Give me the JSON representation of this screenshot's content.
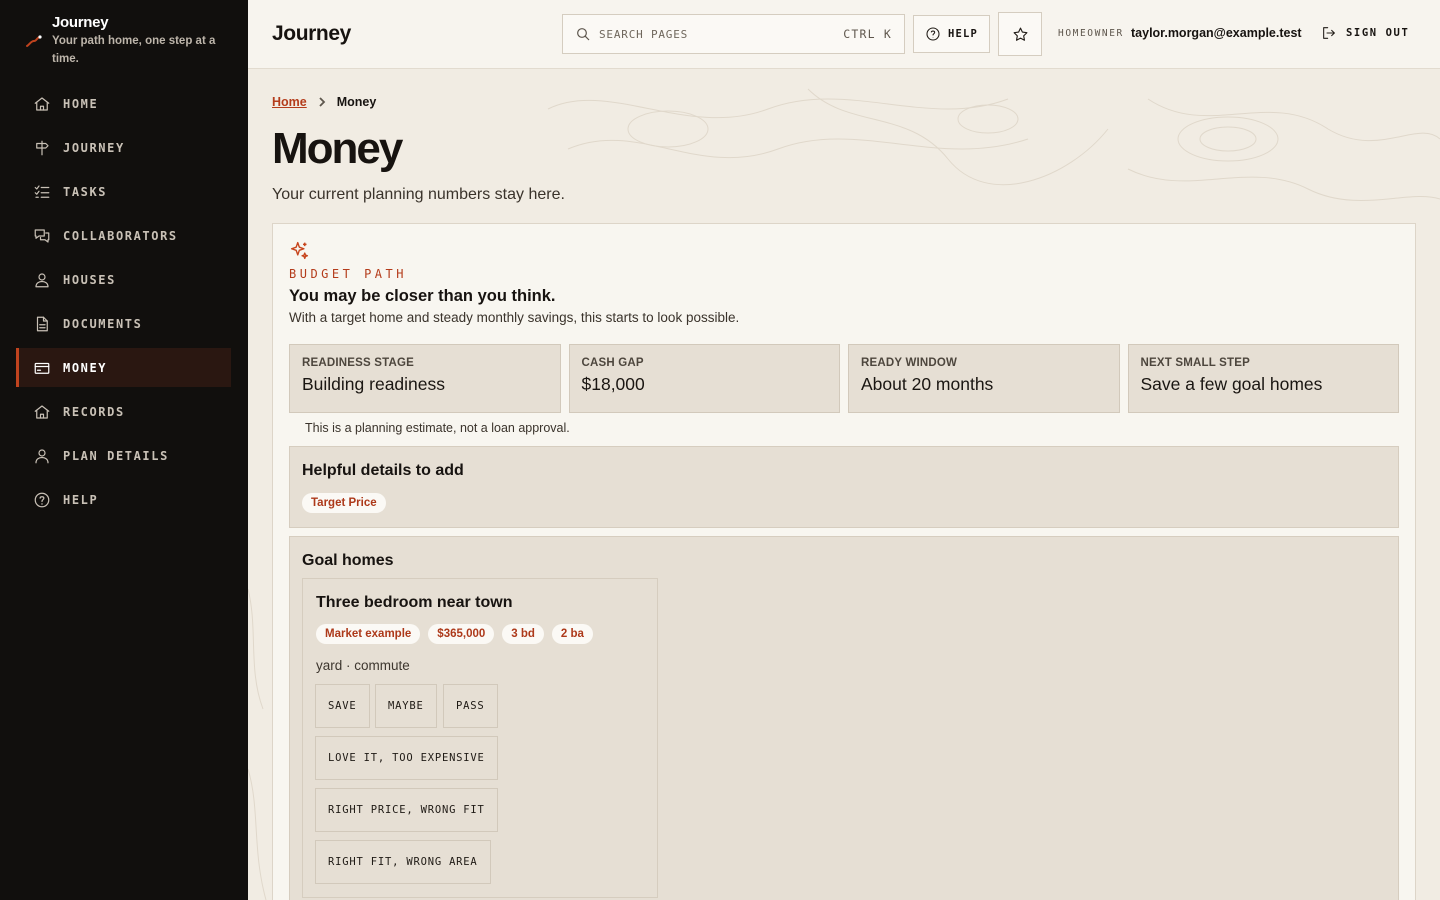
{
  "brand": {
    "title": "Journey",
    "tagline": "Your path home, one step at a time.",
    "accent": "#c0431e"
  },
  "nav": [
    {
      "label": "HOME",
      "icon": "home-icon"
    },
    {
      "label": "JOURNEY",
      "icon": "signpost-icon"
    },
    {
      "label": "TASKS",
      "icon": "checklist-icon"
    },
    {
      "label": "COLLABORATORS",
      "icon": "chat-icon"
    },
    {
      "label": "HOUSES",
      "icon": "user-search-icon"
    },
    {
      "label": "DOCUMENTS",
      "icon": "document-icon"
    },
    {
      "label": "MONEY",
      "icon": "credit-card-icon",
      "active": true
    },
    {
      "label": "RECORDS",
      "icon": "home-icon"
    },
    {
      "label": "PLAN DETAILS",
      "icon": "person-icon"
    },
    {
      "label": "HELP",
      "icon": "help-circle-icon"
    }
  ],
  "header": {
    "title": "Journey",
    "search_placeholder": "SEARCH PAGES",
    "search_shortcut": "CTRL K",
    "help_label": "HELP",
    "role": "HOMEOWNER",
    "email": "taylor.morgan@example.test",
    "signout_label": "SIGN OUT"
  },
  "breadcrumb": {
    "home": "Home",
    "current": "Money"
  },
  "page": {
    "title": "Money",
    "subtitle": "Your current planning numbers stay here."
  },
  "budget": {
    "eyebrow": "BUDGET PATH",
    "heading": "You may be closer than you think.",
    "description": "With a target home and steady monthly savings, this starts to look possible.",
    "stats": [
      {
        "label": "READINESS STAGE",
        "value": "Building readiness"
      },
      {
        "label": "CASH GAP",
        "value": "$18,000"
      },
      {
        "label": "READY WINDOW",
        "value": "About 20 months"
      },
      {
        "label": "NEXT SMALL STEP",
        "value": "Save a few goal homes"
      }
    ],
    "disclaimer": "This is a planning estimate, not a loan approval."
  },
  "helpful": {
    "title": "Helpful details to add",
    "chip": "Target Price"
  },
  "goals": {
    "title": "Goal homes",
    "home": {
      "title": "Three bedroom near town",
      "chips": [
        "Market example",
        "$365,000",
        "3 bd",
        "2 ba"
      ],
      "tags": "yard · commute",
      "actions": [
        "SAVE",
        "MAYBE",
        "PASS"
      ],
      "feedback": [
        "LOVE IT, TOO EXPENSIVE",
        "RIGHT PRICE, WRONG FIT",
        "RIGHT FIT, WRONG AREA"
      ]
    }
  }
}
